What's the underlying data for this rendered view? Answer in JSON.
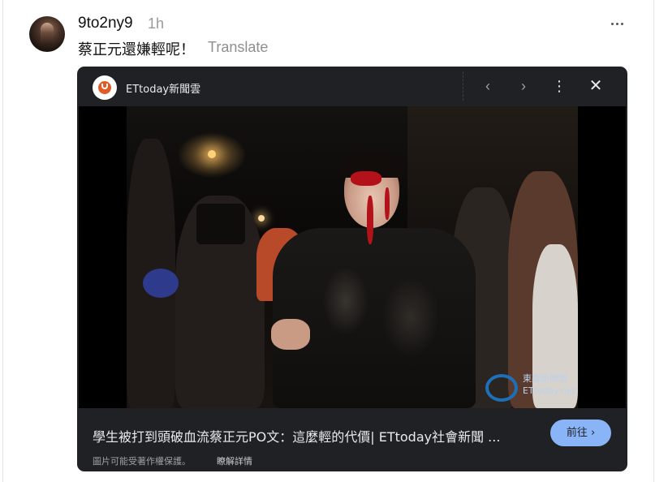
{
  "post": {
    "username": "9to2ny9",
    "time_ago": "1h",
    "text": "蔡正元還嫌輕呢！",
    "translate_label": "Translate"
  },
  "icons": {
    "more": "more-horizontal-icon",
    "prev": "chevron-left-icon",
    "next": "chevron-right-icon",
    "menu": "more-vertical-icon",
    "close": "close-icon"
  },
  "viewer": {
    "source_name": "ETtoday新聞雲",
    "prev_glyph": "‹",
    "next_glyph": "›",
    "menu_glyph": "⋮",
    "close_glyph": "✕",
    "image_watermark": [
      "東森新聞雲",
      "ETtoday.net"
    ],
    "title": "學生被打到頭破血流蔡正元PO文：這麼輕的代價| ETtoday社會新聞 ...",
    "visit_label": "前往 ›",
    "copyright_notice": "圖片可能受著作權保護。",
    "learn_more": "瞭解詳情"
  },
  "colors": {
    "card_bg": "#202124",
    "visit_button": "#8ab4f8",
    "source_logo": "#e25b26"
  }
}
